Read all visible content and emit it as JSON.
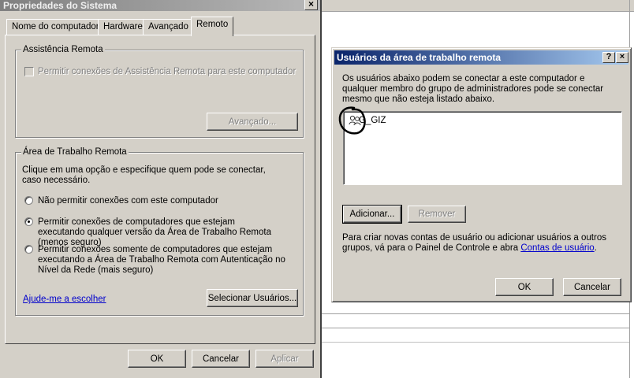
{
  "system_properties": {
    "title": "Propriedades do Sistema",
    "tabs": [
      {
        "label": "Nome do computador"
      },
      {
        "label": "Hardware"
      },
      {
        "label": "Avançado"
      },
      {
        "label": "Remoto",
        "active": true
      }
    ],
    "remote_assistance": {
      "group_label": "Assistência Remota",
      "checkbox_label": "Permitir conexões de Assistência Remota para este computador",
      "checkbox_checked": false,
      "advanced_button": "Avançado..."
    },
    "remote_desktop": {
      "group_label": "Área de Trabalho Remota",
      "description": "Clique em uma opção e especifique quem pode se conectar, caso necessário.",
      "options": [
        {
          "label": "Não permitir conexões com este computador",
          "checked": false
        },
        {
          "label": "Permitir conexões de computadores que estejam executando qualquer versão da Área de Trabalho Remota (menos seguro)",
          "checked": true
        },
        {
          "label": "Permitir conexões somente de computadores que estejam executando a Área de Trabalho Remota com Autenticação no Nível da Rede (mais seguro)",
          "checked": false
        }
      ],
      "help_link": "Ajude-me a escolher",
      "select_users_button": "Selecionar Usuários..."
    },
    "buttons": {
      "ok": "OK",
      "cancel": "Cancelar",
      "apply": "Aplicar"
    }
  },
  "remote_users": {
    "title": "Usuários da área de trabalho remota",
    "help_btn": "?",
    "close_btn": "×",
    "description": "Os usuários abaixo podem se conectar a este computador e qualquer membro do grupo de administradores pode se conectar mesmo que não esteja listado abaixo.",
    "users": [
      {
        "name": "G_GIZ",
        "icon": "user-group-icon"
      }
    ],
    "add_button": "Adicionar...",
    "remove_button": "Remover",
    "footer_text": "Para criar novas contas de usuário ou adicionar usuários a outros grupos, vá para o Painel de Controle e abra",
    "footer_link": "Contas de usuário",
    "footer_end": ".",
    "ok": "OK",
    "cancel": "Cancelar"
  },
  "colors": {
    "dialog_bg": "#d4d0c8",
    "active_title": "#0a246a",
    "inactive_title": "#808080",
    "link": "#0000cc",
    "annotation": "#000000"
  }
}
